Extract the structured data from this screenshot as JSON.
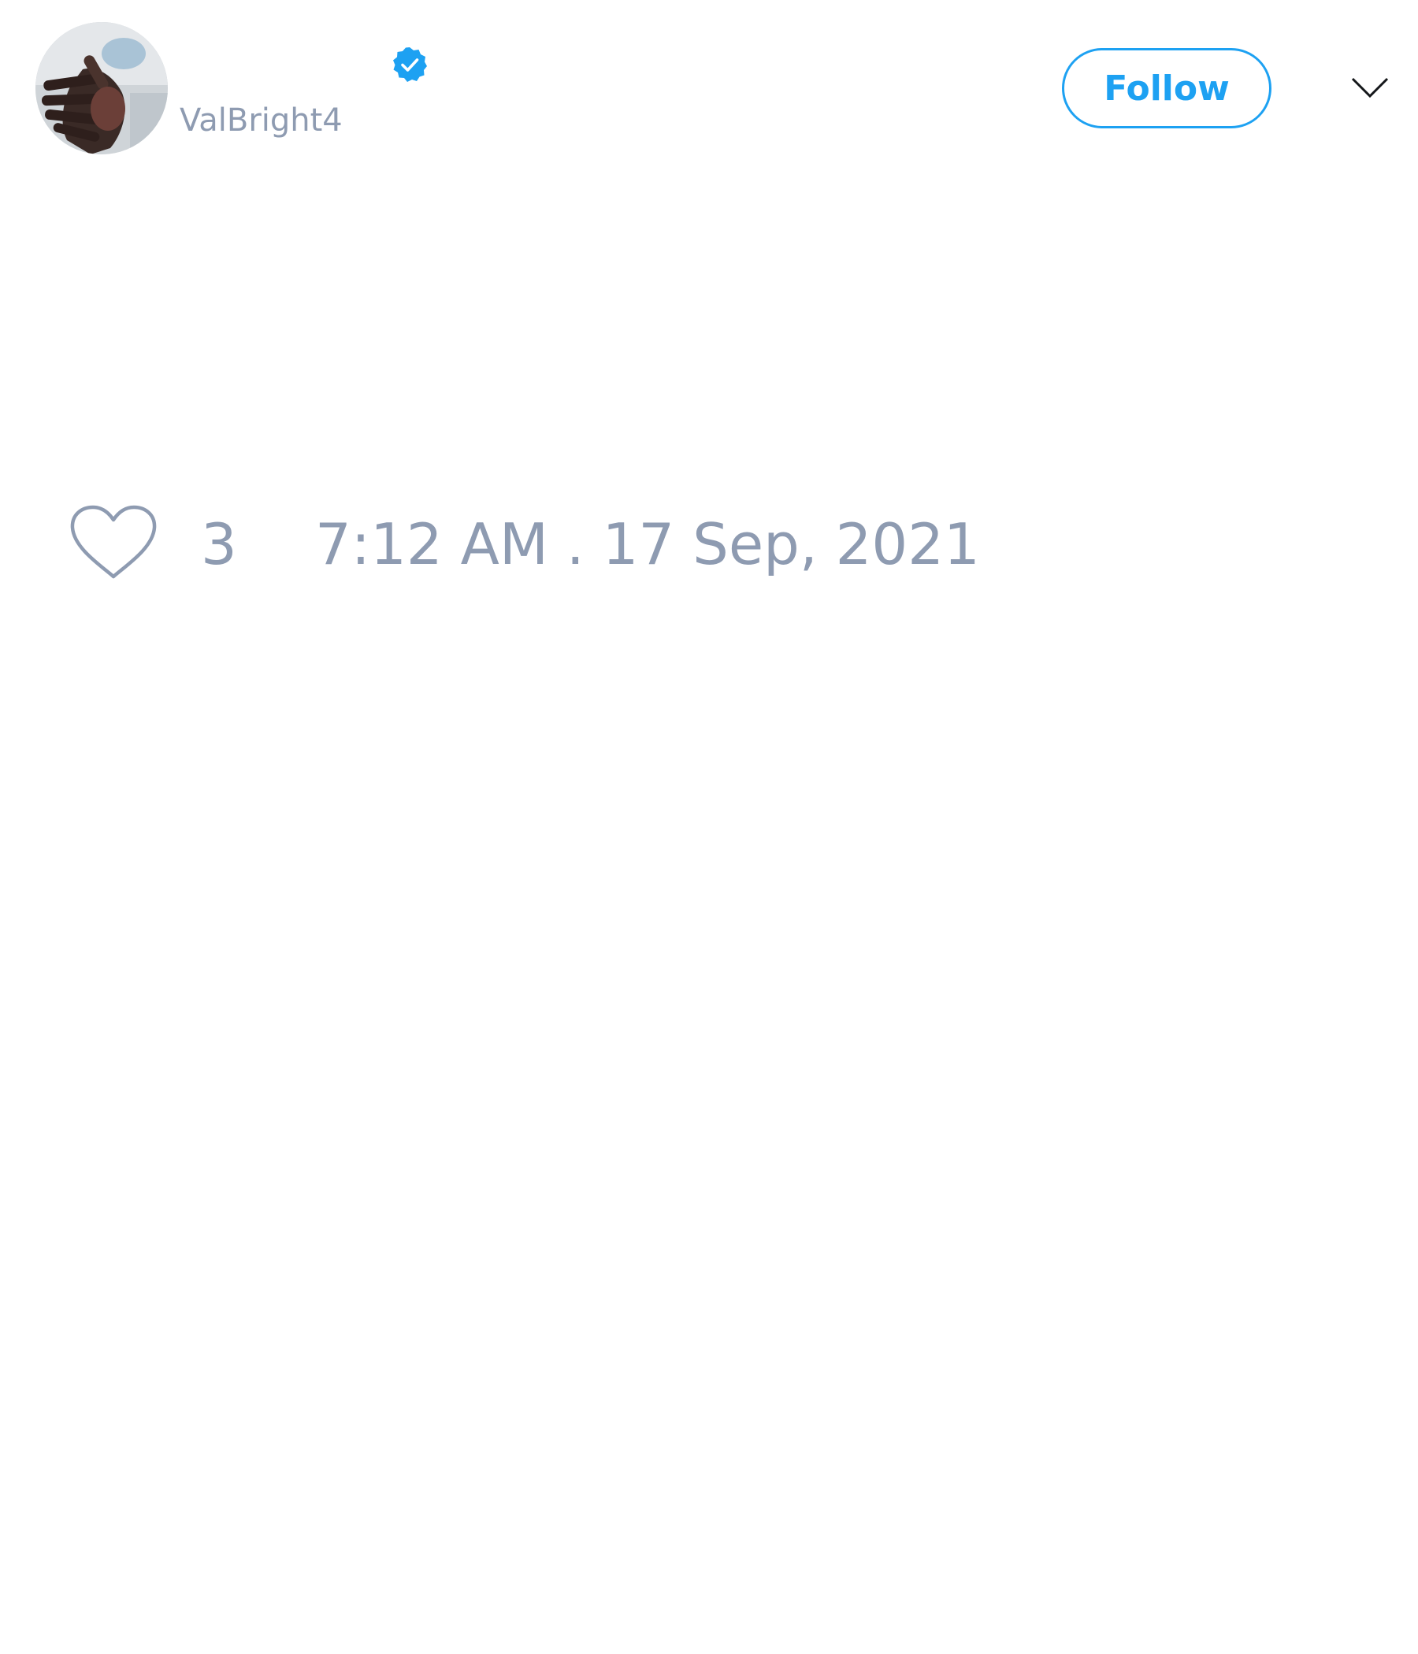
{
  "author": {
    "display_name": "",
    "handle": "ValBright4",
    "verified": true,
    "avatar_icon": "avatar-photo-hand"
  },
  "header": {
    "follow_label": "Follow",
    "menu_icon": "chevron-down-icon"
  },
  "footer": {
    "like_icon": "heart-outline-icon",
    "like_count": "3",
    "timestamp": "7:12 AM . 17 Sep, 2021"
  },
  "colors": {
    "accent": "#1da1f2",
    "muted_text": "#8e9bb1",
    "background": "#ffffff"
  }
}
